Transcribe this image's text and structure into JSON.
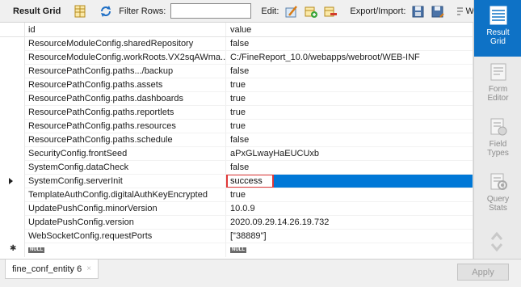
{
  "toolbar": {
    "result_grid_label": "Result Grid",
    "filter_rows_label": "Filter Rows:",
    "filter_value": "",
    "edit_label": "Edit:",
    "export_import_label": "Export/Import:",
    "wrap_label": "Wrap C"
  },
  "grid": {
    "columns": [
      "id",
      "value"
    ],
    "rows": [
      {
        "id": "ResourceModuleConfig.sharedRepository",
        "value": "false"
      },
      {
        "id": "ResourceModuleConfig.workRoots.VX2sqAWma...",
        "value": "C:/FineReport_10.0/webapps/webroot/WEB-INF"
      },
      {
        "id": "ResourcePathConfig.paths.../backup",
        "value": "false"
      },
      {
        "id": "ResourcePathConfig.paths.assets",
        "value": "true"
      },
      {
        "id": "ResourcePathConfig.paths.dashboards",
        "value": "true"
      },
      {
        "id": "ResourcePathConfig.paths.reportlets",
        "value": "true"
      },
      {
        "id": "ResourcePathConfig.paths.resources",
        "value": "true"
      },
      {
        "id": "ResourcePathConfig.paths.schedule",
        "value": "false"
      },
      {
        "id": "SecurityConfig.frontSeed",
        "value": "aPxGLwayHaEUCUxb"
      },
      {
        "id": "SystemConfig.dataCheck",
        "value": "false"
      },
      {
        "id": "SystemConfig.serverInit",
        "value": "success"
      },
      {
        "id": "TemplateAuthConfig.digitalAuthKeyEncrypted",
        "value": "true"
      },
      {
        "id": "UpdatePushConfig.minorVersion",
        "value": "10.0.9"
      },
      {
        "id": "UpdatePushConfig.version",
        "value": "2020.09.29.14.26.19.732"
      },
      {
        "id": "WebSocketConfig.requestPorts",
        "value": "[\"38889\"]"
      }
    ],
    "null_label": "NULL",
    "selected_row_index": 10
  },
  "side_panel": {
    "result_grid": "Result Grid",
    "form_editor": "Form Editor",
    "field_types": "Field Types",
    "query_stats": "Query Stats"
  },
  "bottom": {
    "tab_label": "fine_conf_entity 6",
    "tab_close": "×",
    "apply_label": "Apply"
  },
  "colors": {
    "accent": "#0e72c6",
    "selection": "#0078d7",
    "highlight_border": "#e03838"
  }
}
